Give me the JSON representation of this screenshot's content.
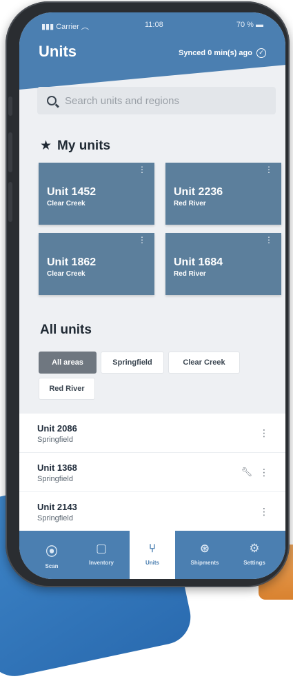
{
  "status": {
    "carrier": "Carrier",
    "time": "11:08",
    "battery": "70 %"
  },
  "header": {
    "title": "Units",
    "sync": "Synced 0 min(s) ago"
  },
  "search": {
    "placeholder": "Search units and regions"
  },
  "my_units": {
    "title": "My units",
    "cards": [
      {
        "name": "Unit 1452",
        "area": "Clear Creek"
      },
      {
        "name": "Unit 2236",
        "area": "Red River"
      },
      {
        "name": "Unit 1862",
        "area": "Clear Creek"
      },
      {
        "name": "Unit 1684",
        "area": "Red River"
      }
    ]
  },
  "all_units": {
    "title": "All units",
    "filters": [
      {
        "label": "All areas",
        "selected": true
      },
      {
        "label": "Springfield"
      },
      {
        "label": "Clear Creek"
      },
      {
        "label": "Red River"
      }
    ],
    "rows": [
      {
        "name": "Unit 2086",
        "area": "Springfield"
      },
      {
        "name": "Unit 1368",
        "area": "Springfield",
        "icon": "wrench-icon"
      },
      {
        "name": "Unit 2143",
        "area": "Springfield"
      }
    ]
  },
  "tabs": [
    {
      "label": "Scan",
      "icon": "scan-icon"
    },
    {
      "label": "Inventory",
      "icon": "clipboard-icon"
    },
    {
      "label": "Units",
      "icon": "network-icon",
      "active": true
    },
    {
      "label": "Shipments",
      "icon": "package-icon"
    },
    {
      "label": "Settings",
      "icon": "gear-icon"
    }
  ],
  "colors": {
    "primary": "#4b7fb1",
    "card": "#5c7f9c",
    "background": "#eef0f3"
  }
}
